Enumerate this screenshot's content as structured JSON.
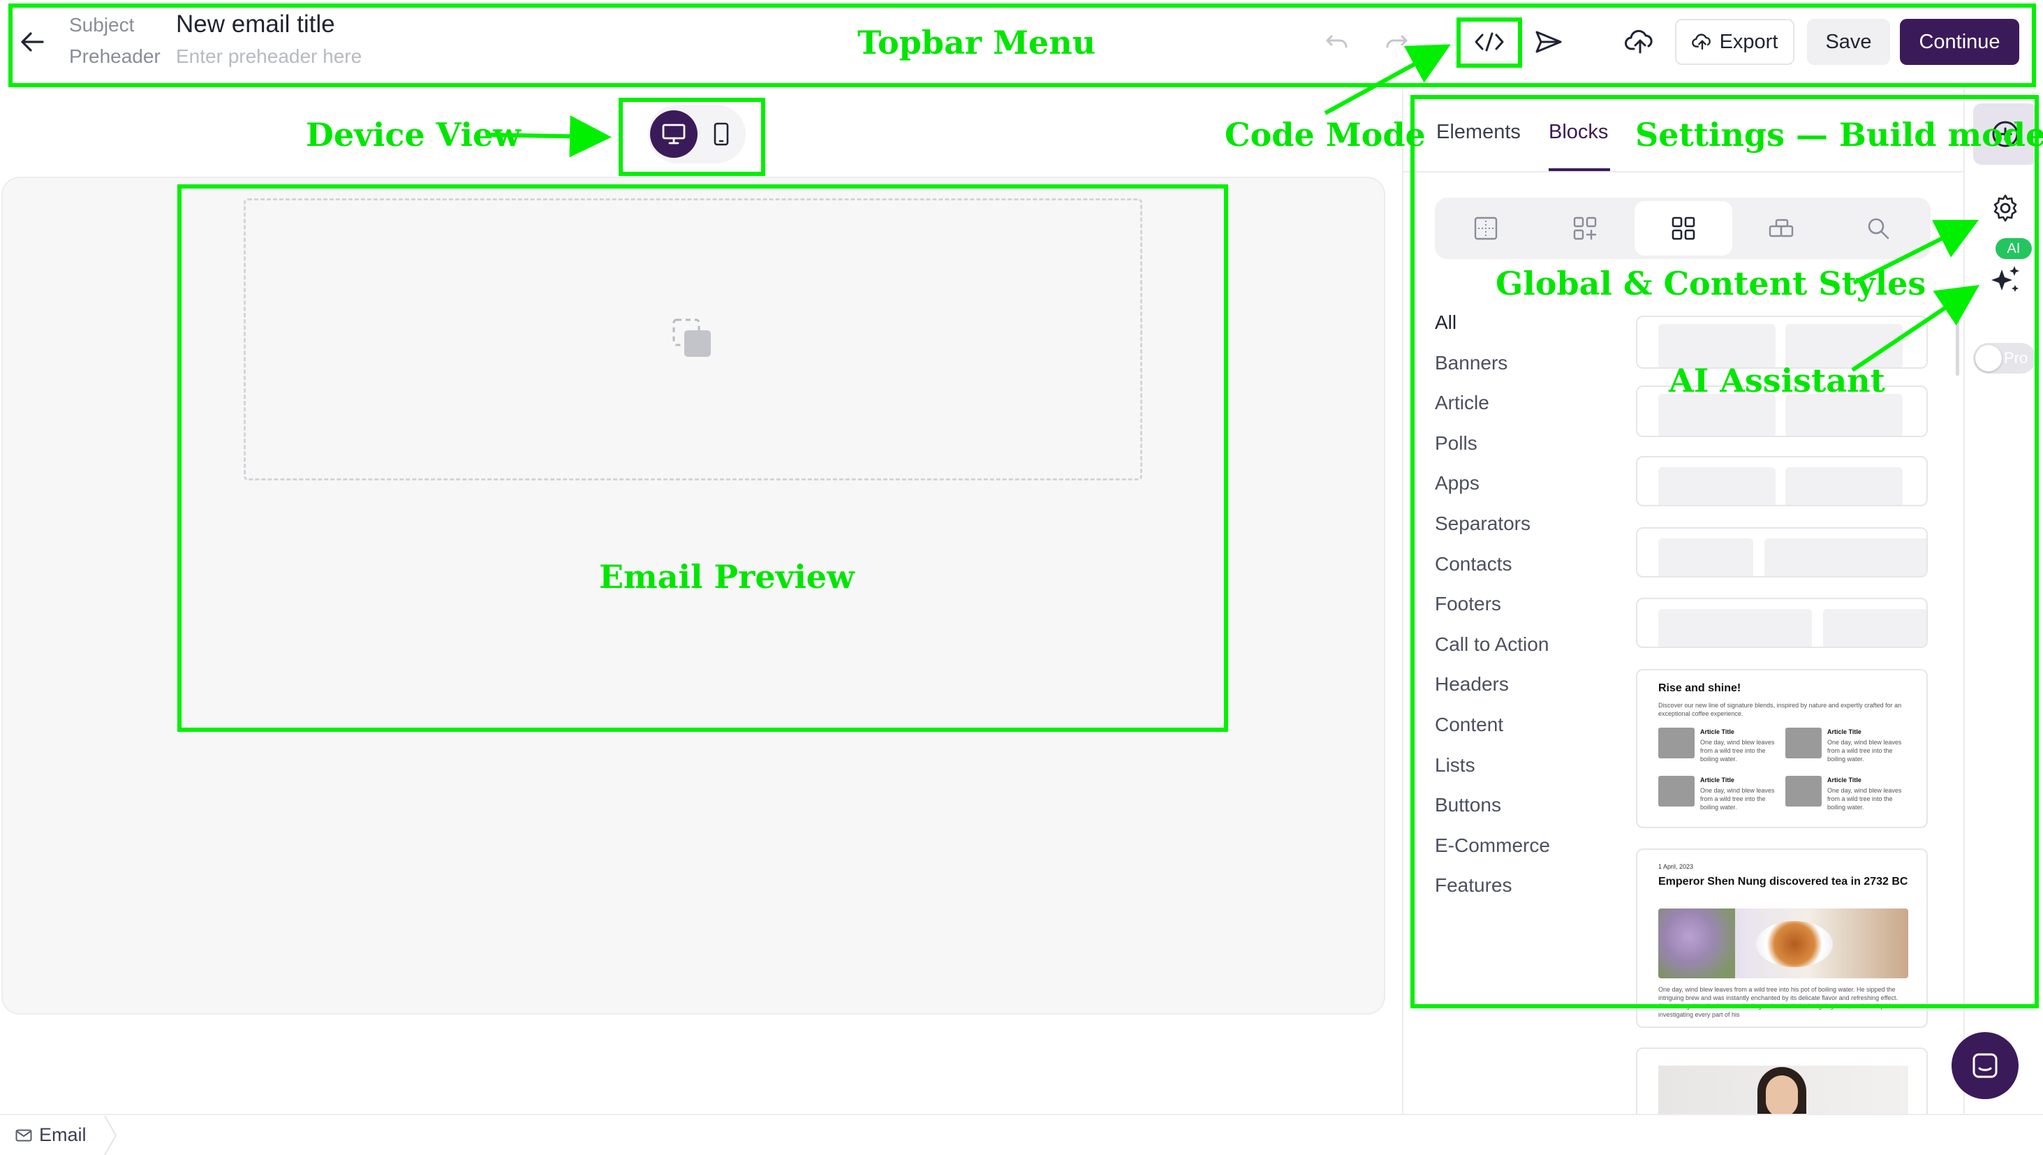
{
  "topbar": {
    "subject_label": "Subject",
    "subject_value": "New email title",
    "preheader_label": "Preheader",
    "preheader_placeholder": "Enter preheader here",
    "export_label": "Export",
    "save_label": "Save",
    "continue_label": "Continue"
  },
  "annotations": {
    "topbar": "Topbar Menu",
    "device_view": "Device View",
    "code_mode": "Code Mode",
    "settings": "Settings — Build mode",
    "styles": "Global & Content Styles",
    "ai": "AI Assistant",
    "preview": "Email Preview"
  },
  "panel": {
    "tabs": [
      "Elements",
      "Blocks"
    ],
    "active_tab": "Blocks",
    "categories": [
      "All",
      "Banners",
      "Article",
      "Polls",
      "Apps",
      "Separators",
      "Contacts",
      "Footers",
      "Call to Action",
      "Headers",
      "Content",
      "Lists",
      "Buttons",
      "E-Commerce",
      "Features"
    ],
    "active_category": "All"
  },
  "side_rail": {
    "ai_badge": "AI",
    "pro_label": "Pro"
  },
  "cards": {
    "rise": {
      "title": "Rise and shine!",
      "intro": "Discover our new line of signature blends, inspired by nature and expertly crafted for an exceptional coffee experience.",
      "item_title": "Article Title",
      "item_text": "One day, wind blew leaves from a wild tree into the boiling water."
    },
    "tea": {
      "date": "1 April, 2023",
      "title": "Emperor Shen Nung discovered tea in 2732 BC",
      "body": "One day, wind blew leaves from a wild tree into his pot of boiling water. He sipped the intriguing brew and was instantly enchanted by its delicate flavor and refreshing effect. Shen Nung described a warm feeling as he drank the intriguing brew, as if the liquid was investigating every part of his"
    }
  },
  "bottombar": {
    "tab_label": "Email"
  },
  "colors": {
    "accent": "#3b1a5a",
    "annotation": "#00e600",
    "ai_badge": "#22c55e"
  }
}
